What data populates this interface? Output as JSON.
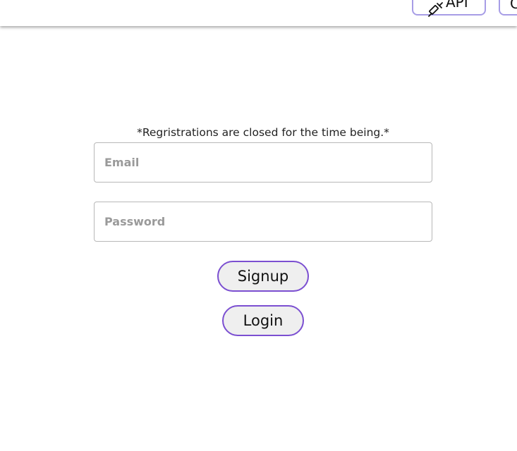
{
  "header": {
    "api_label": "API",
    "api_icon": "syringe-icon",
    "extra_label": "C"
  },
  "form": {
    "notice": "*Regristrations are closed for the time being.*",
    "email_placeholder": "Email",
    "password_placeholder": "Password",
    "signup_label": "Signup",
    "login_label": "Login"
  },
  "colors": {
    "accent": "#7b4fd1",
    "nav_border": "#a79de6"
  }
}
